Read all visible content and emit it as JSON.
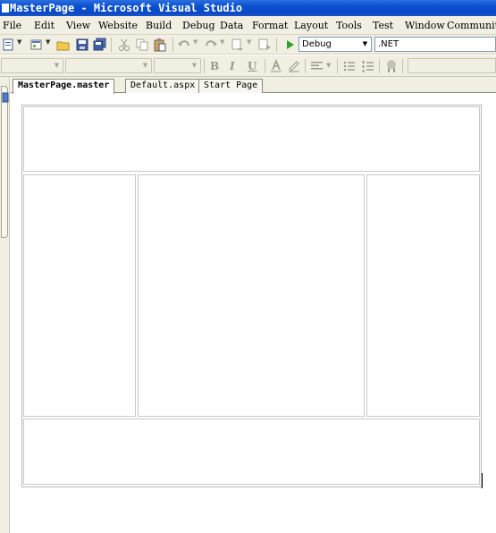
{
  "window": {
    "title": "MasterPage - Microsoft Visual Studio"
  },
  "menu": [
    "File",
    "Edit",
    "View",
    "Website",
    "Build",
    "Debug",
    "Data",
    "Format",
    "Layout",
    "Tools",
    "Test",
    "Window",
    "Community"
  ],
  "toolbar": {
    "config_value": "Debug",
    "platform_value": ".NET",
    "format_bold": "B",
    "format_italic": "I",
    "format_underline": "U"
  },
  "tabs": [
    {
      "label": "MasterPage.master",
      "active": true
    },
    {
      "label": "Default.aspx",
      "active": false
    },
    {
      "label": "Start Page",
      "active": false
    }
  ],
  "icons": {
    "new_project": "new-project-icon",
    "add_item": "add-item-icon",
    "open": "open-folder-icon",
    "save": "save-icon",
    "save_all": "save-all-icon",
    "cut": "cut-icon",
    "copy": "copy-icon",
    "paste": "paste-icon",
    "undo": "undo-icon",
    "redo": "redo-icon",
    "start": "start-debug-icon"
  },
  "colors": {
    "title_bar": "#0b49c4",
    "chrome": "#f1efe2",
    "start_green": "#2f9e2f"
  }
}
